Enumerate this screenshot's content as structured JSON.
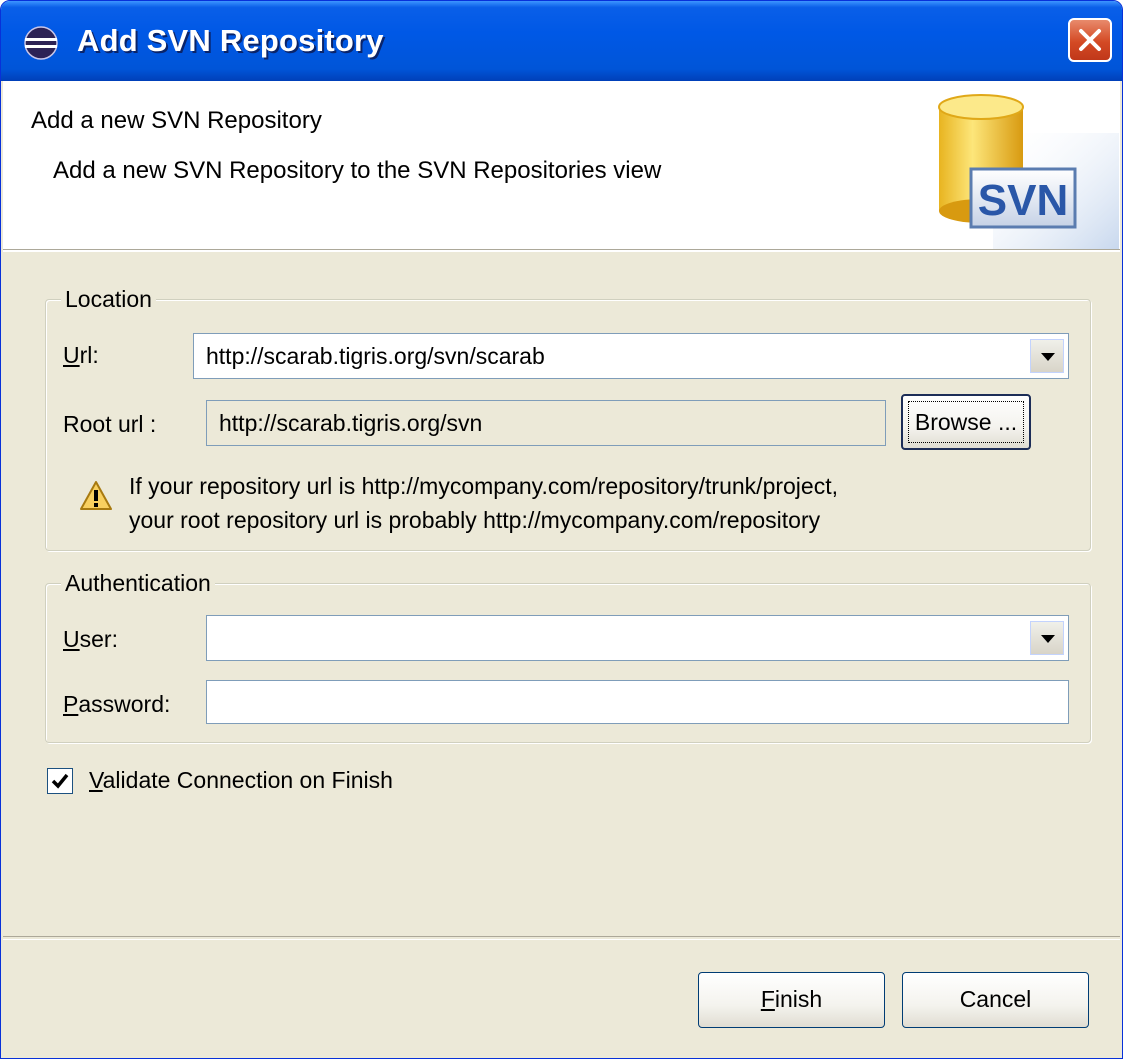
{
  "window": {
    "title": "Add SVN Repository"
  },
  "banner": {
    "title": "Add a new SVN Repository",
    "description": "Add a new SVN Repository to the SVN Repositories view",
    "logo_text": "SVN"
  },
  "location": {
    "group_label": "Location",
    "url_label_mnemonic": "U",
    "url_label_rest": "rl:",
    "url_value": "http://scarab.tigris.org/svn/scarab",
    "root_url_label": "Root url :",
    "root_url_value": "http://scarab.tigris.org/svn",
    "browse_label": "Browse ...",
    "warning_line1": "If your repository url is http://mycompany.com/repository/trunk/project,",
    "warning_line2": "your root repository url is probably http://mycompany.com/repository"
  },
  "authentication": {
    "group_label": "Authentication",
    "user_label_mnemonic": "U",
    "user_label_rest": "ser:",
    "user_value": "",
    "password_label_mnemonic": "P",
    "password_label_rest": "assword:",
    "password_value": ""
  },
  "validate": {
    "checked": true,
    "label_mnemonic": "V",
    "label_rest": "alidate Connection on Finish"
  },
  "buttons": {
    "finish_mnemonic": "F",
    "finish_rest": "inish",
    "cancel": "Cancel"
  },
  "colors": {
    "titlebar": "#0058e6",
    "dialog_bg": "#ece9d8",
    "close_button": "#d44a24"
  },
  "icons": {
    "app": "eclipse-icon",
    "close": "close-icon",
    "warning": "warning-icon",
    "logo": "svn-repository-icon",
    "dropdown": "chevron-down-icon",
    "check": "checkmark-icon"
  }
}
